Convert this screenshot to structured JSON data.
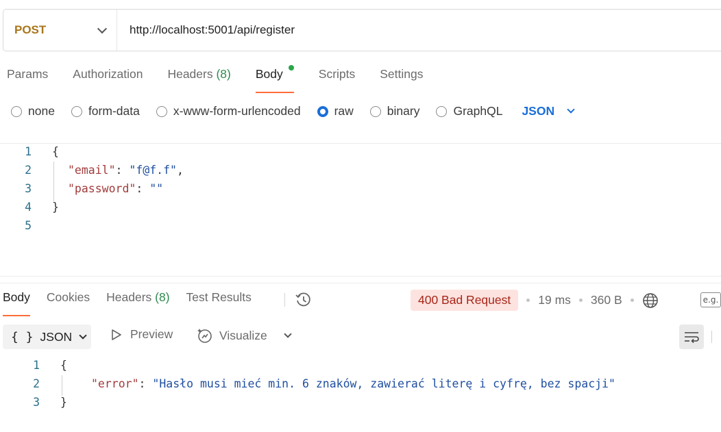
{
  "request": {
    "method": "POST",
    "url": "http://localhost:5001/api/register"
  },
  "request_tabs": {
    "params": "Params",
    "authorization": "Authorization",
    "headers": "Headers",
    "headers_count": "(8)",
    "body": "Body",
    "scripts": "Scripts",
    "settings": "Settings"
  },
  "body_types": {
    "none": "none",
    "form_data": "form-data",
    "urlencoded": "x-www-form-urlencoded",
    "raw": "raw",
    "binary": "binary",
    "graphql": "GraphQL",
    "language": "JSON"
  },
  "request_body": {
    "line_numbers": [
      "1",
      "2",
      "3",
      "4",
      "5"
    ],
    "open_brace": "{",
    "email_key": "\"email\"",
    "email_value": "\"f@f.f\"",
    "password_key": "\"password\"",
    "password_value": "\"\"",
    "close_brace": "}"
  },
  "response_tabs": {
    "body": "Body",
    "cookies": "Cookies",
    "headers": "Headers",
    "headers_count": "(8)",
    "test_results": "Test Results"
  },
  "response_meta": {
    "status": "400 Bad Request",
    "status_color": "#a7261a",
    "time": "19 ms",
    "size": "360 B"
  },
  "response_toolbar": {
    "format": "JSON",
    "preview": "Preview",
    "visualize": "Visualize"
  },
  "response_body": {
    "line_numbers": [
      "1",
      "2",
      "3"
    ],
    "open_brace": "{",
    "error_key": "\"error\"",
    "error_value": "\"Hasło musi mieć min. 6 znaków, zawierać literę i cyfrę, bez spacji\"",
    "close_brace": "}"
  },
  "icons": [
    "chevron-down-icon",
    "history-icon",
    "globe-icon",
    "example-icon",
    "play-icon",
    "visualize-icon",
    "wrap-icon"
  ],
  "colors": {
    "accent": "#ff6c37",
    "method": "#a9761a",
    "link": "#1a6ed8"
  }
}
